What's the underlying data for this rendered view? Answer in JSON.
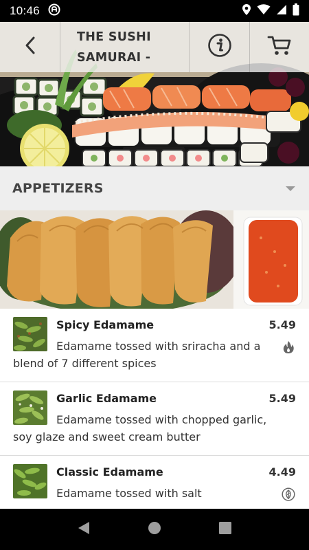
{
  "status_bar": {
    "time": "10:46"
  },
  "header": {
    "title_line1": "THE SUSHI",
    "title_line2": "SAMURAI -"
  },
  "category": {
    "label": "APPETIZERS"
  },
  "menu_items": [
    {
      "name": "Spicy Edamame",
      "price": "5.49",
      "description": "Edamame tossed with sriracha and a blend of 7 different spices",
      "badge_icon": "flame-icon"
    },
    {
      "name": "Garlic Edamame",
      "price": "5.49",
      "description": "Edamame tossed with chopped garlic, soy glaze and sweet cream butter",
      "badge_icon": ""
    },
    {
      "name": "Classic Edamame",
      "price": "4.49",
      "description": "Edamame tossed with salt",
      "badge_icon": "vegetarian-leaf-icon"
    }
  ],
  "colors": {
    "status_bar_bg": "#000000",
    "header_overlay": "#f5f5f5",
    "category_bg": "#eeeeee",
    "text_dark": "#222222",
    "divider": "#dcdcdc"
  }
}
